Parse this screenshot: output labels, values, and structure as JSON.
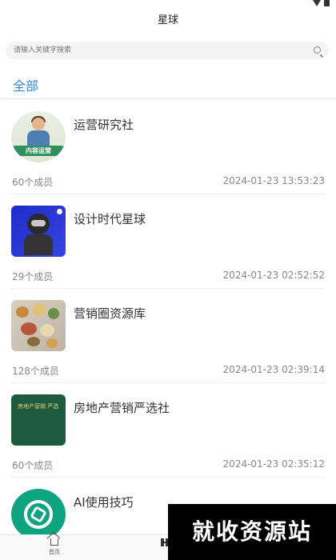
{
  "header": {
    "title": "星球"
  },
  "search": {
    "placeholder": "请输入关键字搜索",
    "icon": "search-icon"
  },
  "filter": {
    "all_label": "全部",
    "accent_color": "#3a86d9"
  },
  "items": [
    {
      "name": "运营研究社",
      "members": "60个成员",
      "time": "2024-01-23 13:53:23",
      "thumb_caption": "内容运营"
    },
    {
      "name": "设计时代星球",
      "members": "29个成员",
      "time": "2024-01-23 02:52:52"
    },
    {
      "name": "营销圈资源库",
      "members": "128个成员",
      "time": "2024-01-23 02:39:14"
    },
    {
      "name": "房地产营销严选社",
      "members": "60个成员",
      "time": "2024-01-23 02:35:12",
      "thumb_caption": "房地产营销 严选"
    },
    {
      "name": "AI使用技巧"
    }
  ],
  "tabbar": {
    "home_label": "首页",
    "home_icon": "home-icon",
    "second_icon": "grid-icon"
  },
  "watermark": {
    "text": "就收资源站"
  }
}
